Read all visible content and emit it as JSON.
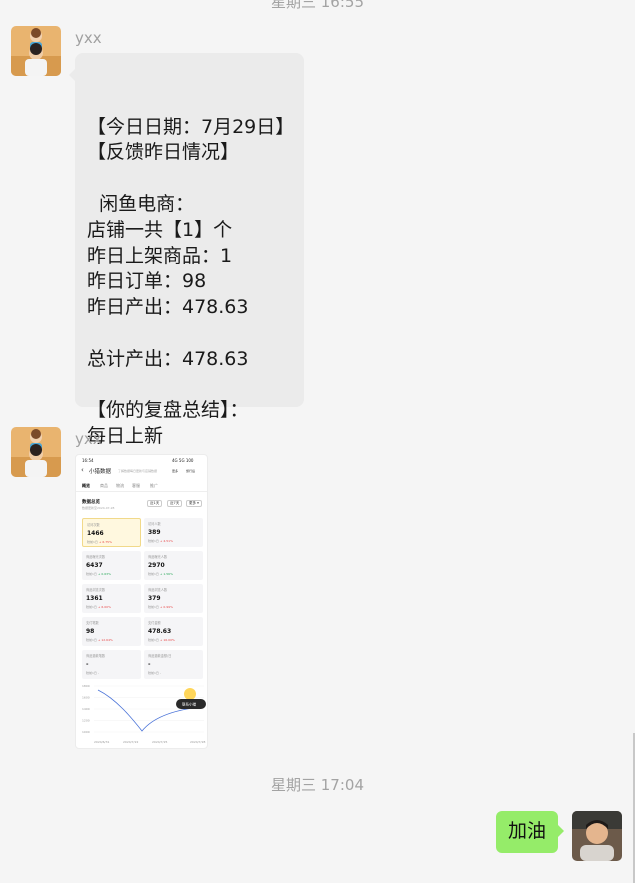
{
  "time_top": "星期三 16:55",
  "time_mid": "星期三 17:04",
  "messages": {
    "m1": {
      "sender": "yxx",
      "lines": [
        "【今日日期：7月29日】",
        "【反馈昨日情况】",
        "",
        "  闲鱼电商：",
        "店铺一共【1】个",
        "昨日上架商品：1",
        "昨日订单：98",
        "昨日产出：478.63",
        "",
        "总计产出：478.63",
        "",
        "【你的复盘总结】：",
        "每日上新"
      ]
    },
    "m2": {
      "sender": "yxx"
    },
    "m3": {
      "text": "加油"
    }
  },
  "mini": {
    "status_time": "16:54",
    "status_right": "4G 5G 100",
    "title": "小猎数据",
    "title_note": "了解数据每日更新与店铺数据",
    "header_btn1": "更多",
    "header_btn2": "旅行后",
    "tabs": [
      "概览",
      "商品",
      "物流",
      "客服",
      "推广"
    ],
    "section_title": "数据总览",
    "section_date": "数据更新至2024-07-28",
    "filters": [
      "近1天",
      "近7天",
      "更多 ▾"
    ],
    "cards": [
      {
        "label": "访问次数",
        "value": "1466",
        "delta_label": "较前1日",
        "delta": "+ 6.75%",
        "dir": "up",
        "highlight": true
      },
      {
        "label": "访问人数",
        "value": "389",
        "delta_label": "较前1日",
        "delta": "+ 4.51%",
        "dir": "up"
      },
      {
        "label": "商品曝光次数",
        "value": "6437",
        "delta_label": "较前1日",
        "delta": "+ 0.63%",
        "dir": "down"
      },
      {
        "label": "商品曝光人数",
        "value": "2970",
        "delta_label": "较前1日",
        "delta": "+ 1.56%",
        "dir": "down"
      },
      {
        "label": "商品浏览次数",
        "value": "1361",
        "delta_label": "较前1日",
        "delta": "+ 6.00%",
        "dir": "up"
      },
      {
        "label": "商品浏览人数",
        "value": "379",
        "delta_label": "较前1日",
        "delta": "+ 0.99%",
        "dir": "up"
      },
      {
        "label": "支付笔数",
        "value": "98",
        "delta_label": "较前1日",
        "delta": "+ 12.64%",
        "dir": "up"
      },
      {
        "label": "支付金额",
        "value": "478.63",
        "delta_label": "较前1日",
        "delta": "+ 16.00%",
        "dir": "up"
      },
      {
        "label": "商品退款笔数",
        "value": "-",
        "delta_label": "较前1日",
        "delta": "-",
        "dir": "none"
      },
      {
        "label": "商品退款金额/日",
        "value": "-",
        "delta_label": "较前1日",
        "delta": "-",
        "dir": "none"
      }
    ],
    "chart_yticks": [
      "1800",
      "1600",
      "1400",
      "1200",
      "1000"
    ],
    "chart_xticks": [
      "2024/6/31",
      "2024/7/22",
      "2024/7/25",
      "2024/7/28"
    ],
    "chart_tag": "联系小猎",
    "chart_line_color": "#4a73d8"
  },
  "colors": {
    "page_bg": "#f5f5f5",
    "bubble_in": "#ebebeb",
    "bubble_out": "#95ec69"
  }
}
